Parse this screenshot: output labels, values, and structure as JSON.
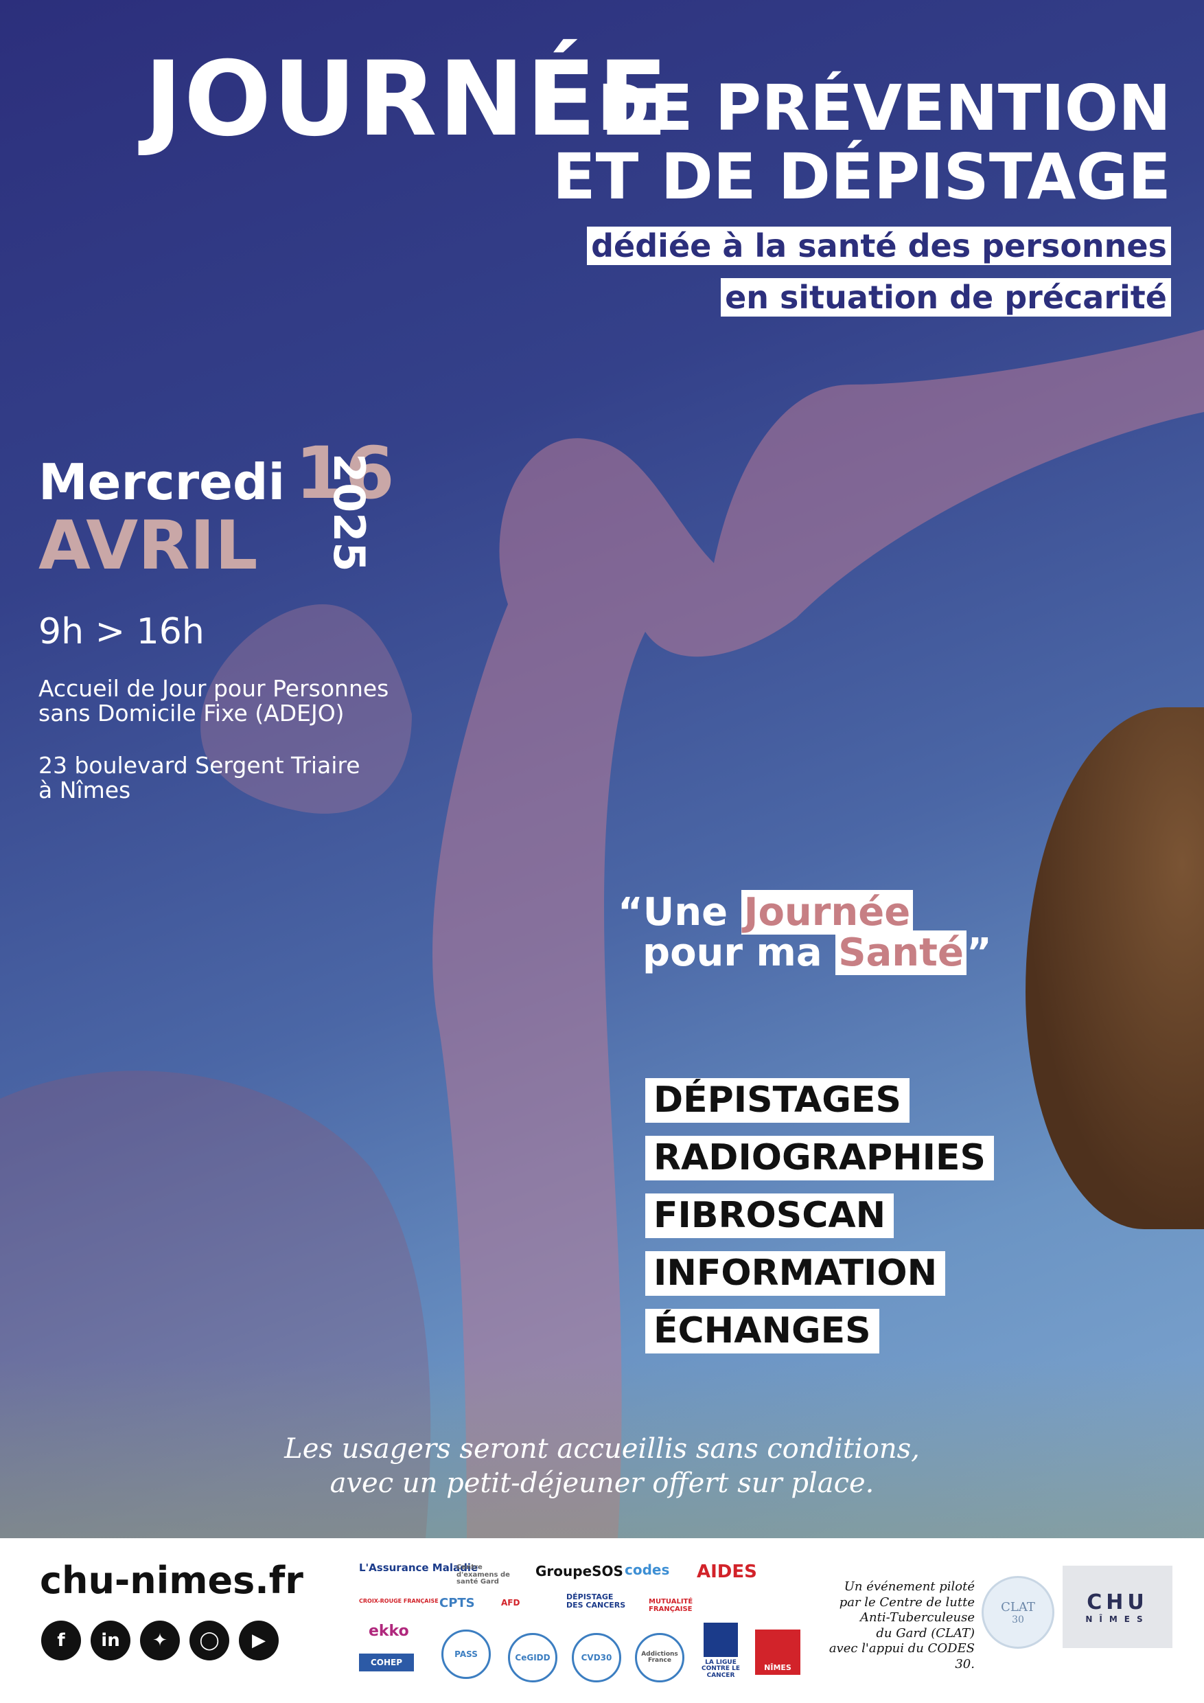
{
  "header": {
    "title_big": "JOURNÉE",
    "title_line1": "DE PRÉVENTION",
    "title_line2": "ET DE DÉPISTAGE",
    "subtitle_line1": "dédiée à la santé des personnes",
    "subtitle_line2": "en situation de précarité"
  },
  "date": {
    "weekday": "Mercredi",
    "day": "16",
    "month": "AVRIL",
    "year": "2025"
  },
  "details": {
    "hours": "9h > 16h",
    "place_line1": "Accueil de Jour pour Personnes",
    "place_line2": "sans Domicile Fixe (ADEJO)",
    "address_line1": "23 boulevard Sergent Triaire",
    "address_line2": "à Nîmes"
  },
  "quote": {
    "open": "“Une ",
    "word1": "Journée",
    "line2_pre": "pour ma ",
    "word2": "Santé",
    "close": "”"
  },
  "services": [
    "DÉPISTAGES",
    "RADIOGRAPHIES",
    "FIBROSCAN",
    "INFORMATION",
    "ÉCHANGES"
  ],
  "note": {
    "line1": "Les usagers seront accueillis sans conditions,",
    "line2": "avec un petit-déjeuner offert sur place."
  },
  "footer": {
    "website": "chu-nimes.fr",
    "social": [
      "facebook-icon",
      "linkedin-icon",
      "bluesky-icon",
      "instagram-icon",
      "youtube-icon"
    ],
    "logos": {
      "assurance_maladie": "L'Assurance Maladie",
      "centre_examens": "Centre d'examens de santé Gard",
      "groupe_sos": "GroupeSOS",
      "codes": "codes",
      "aides": "AIDES",
      "croix_rouge": "CROIX-ROUGE FRANÇAISE",
      "cpts": "CPTS",
      "afd": "AFD",
      "depistage_cancers": "DÉPISTAGE DES CANCERS",
      "mutualite": "MUTUALITÉ FRANÇAISE",
      "ekko": "ekko",
      "cohep": "COHEP",
      "pass": "PASS",
      "cegidd": "CeGIDD",
      "cvd": "CVD30",
      "addictions": "Addictions France",
      "ligue": "LA LIGUE CONTRE LE CANCER",
      "nimes": "NÎMES"
    },
    "credit": [
      "Un événement piloté",
      "par le Centre de lutte",
      "Anti-Tuberculeuse",
      "du Gard (CLAT)",
      "avec l'appui du CODES 30."
    ],
    "clat": "CLAT",
    "clat_num": "30",
    "chu_letters": "CHU",
    "chu_city": "NÎMES"
  },
  "colors": {
    "navy": "#2c2f7c",
    "rose": "#c9a7a7",
    "quote_rose": "#c77f84"
  }
}
